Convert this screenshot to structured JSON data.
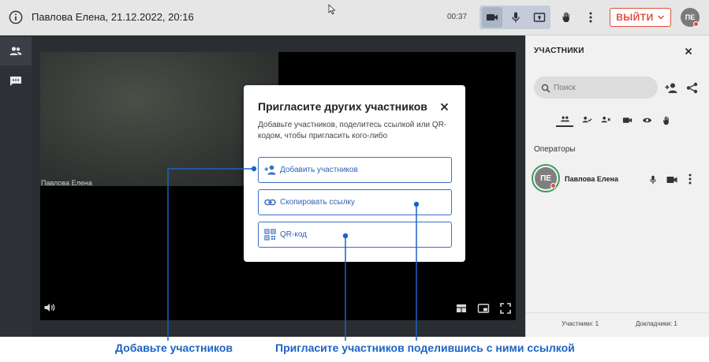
{
  "topbar": {
    "title": "Павлова Елена, 21.12.2022, 20:16",
    "timer": "00:37",
    "exit_label": "ВЫЙТИ",
    "avatar_initials": "ПЕ",
    "icons": [
      "info-icon",
      "camera-icon",
      "microphone-icon",
      "screen-share-icon",
      "raise-hand-icon",
      "more-vertical-icon",
      "chevron-down-icon"
    ]
  },
  "left_rail": {
    "items": [
      {
        "icon": "participants-icon",
        "active": true
      },
      {
        "icon": "chat-icon",
        "active": false
      }
    ]
  },
  "video": {
    "participant_name": "Павлова Елена",
    "controls": [
      "speaker-icon",
      "layout-icon",
      "picture-in-picture-icon",
      "fullscreen-icon"
    ]
  },
  "panel": {
    "title": "УЧАСТНИКИ",
    "search_placeholder": "Поиск",
    "filters": [
      "all-participants-icon",
      "approved-icon",
      "declined-icon",
      "camera-icon",
      "viewer-icon",
      "raised-hand-icon"
    ],
    "section_label": "Операторы",
    "participant": {
      "initials": "ПЕ",
      "name": "Павлова Елена",
      "status_color": "#e44b3b"
    },
    "footer_participants": "Участники: 1",
    "footer_speakers": "Докладчики: 1"
  },
  "modal": {
    "title": "Пригласите других участников",
    "description": "Добавьте участников, поделитесь ссылкой или QR-кодом, чтобы пригласить кого-либо",
    "add_label": "Добавить участников",
    "copy_label": "Скопировать ссылку",
    "qr_label": "QR-код"
  },
  "annotations": {
    "add_caption": "Добавьте участников",
    "share_caption": "Пригласите участников поделившись с ними ссылкой",
    "color": "#1b63c6"
  },
  "colors": {
    "accent": "#2f62b7",
    "danger": "#e44b3b",
    "online": "#3b9a5c"
  }
}
